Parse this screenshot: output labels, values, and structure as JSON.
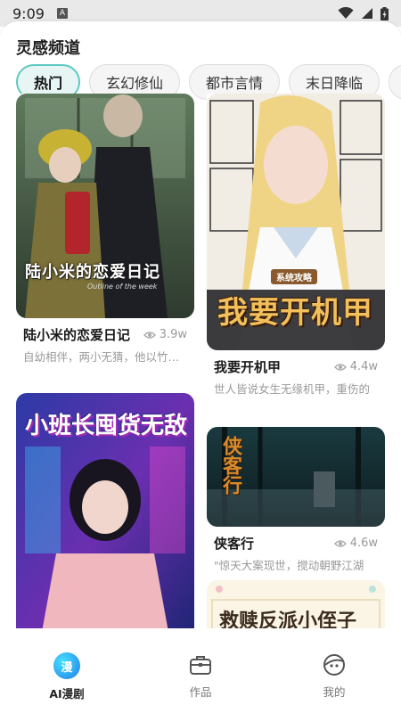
{
  "status_bar": {
    "time": "9:09",
    "notification_glyph": "A"
  },
  "header": {
    "title": "灵感频道"
  },
  "chips": [
    {
      "label": "热门",
      "active": true
    },
    {
      "label": "玄幻修仙",
      "active": false
    },
    {
      "label": "都市言情",
      "active": false
    },
    {
      "label": "末日降临",
      "active": false
    }
  ],
  "cards": [
    {
      "title": "陆小米的恋爱日记",
      "views": "3.9w",
      "desc": "自幼相伴，两小无猜，他以竹马之",
      "cover_text": "陆小米的恋爱日记",
      "cover_sub": "Outline of the week"
    },
    {
      "title": "我要开机甲",
      "views": "4.4w",
      "desc": "世人皆说女生无缘机甲，重伤的",
      "cover_badge": "系统攻略",
      "cover_text": "我要开机甲"
    },
    {
      "title": "小班长囤货无敌",
      "cover_text": "小班长囤货无敌"
    },
    {
      "title": "侠客行",
      "views": "4.6w",
      "desc": "\"惊天大案现世，搅动朝野江湖",
      "cover_text": "侠客行"
    },
    {
      "title": "救赎反派小侄子",
      "cover_text": "救赎反派小侄子"
    }
  ],
  "tabs": [
    {
      "label": "AI漫剧",
      "icon_glyph": "漫",
      "active": true
    },
    {
      "label": "作品",
      "active": false
    },
    {
      "label": "我的",
      "active": false
    }
  ]
}
